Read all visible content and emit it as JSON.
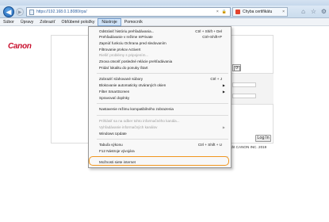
{
  "browser": {
    "url": "https://192.168.0.1.8080/rps/",
    "tab_title": "Chyba certifikátu",
    "url_tools": [
      "×",
      "🔒"
    ]
  },
  "menubar": {
    "items": [
      "Súbor",
      "Úpravy",
      "Zobraziť",
      "Obľúbené položky",
      "Nástroje",
      "Pomocník"
    ],
    "active_index": 4
  },
  "page": {
    "logo": "Canon",
    "login_label": "Log In",
    "copyright": "ight CANON INC. 2019"
  },
  "tools_menu": {
    "items": [
      {
        "label": "Odstrániť históriu prehľadávania...",
        "shortcut": "Ctrl + Shift + Del",
        "disabled": false
      },
      {
        "label": "Prehľadávanie v režime InPrivate",
        "shortcut": "Ctrl+Shift+P",
        "disabled": false
      },
      {
        "label": "Zapnúť funkciu Ochrana pred sledovaním",
        "shortcut": "",
        "disabled": false
      },
      {
        "label": "Filtrovanie prvkov ActiveX",
        "shortcut": "",
        "disabled": false
      },
      {
        "label": "Riešiť problémy s pripojením...",
        "shortcut": "",
        "disabled": true
      },
      {
        "label": "Znova otvoriť posledné relácie prehľadávania",
        "shortcut": "",
        "disabled": false
      },
      {
        "label": "Pridať lokalitu do ponuky Štart",
        "shortcut": "",
        "disabled": false
      },
      {
        "label": "Zobraziť sťahované súbory",
        "shortcut": "Ctrl + J",
        "disabled": false
      },
      {
        "label": "Blokovanie automaticky otváraných okien",
        "shortcut": "",
        "disabled": false,
        "submenu": true
      },
      {
        "label": "Filter SmartScreen",
        "shortcut": "",
        "disabled": false,
        "submenu": true
      },
      {
        "label": "Spravovať doplnky",
        "shortcut": "",
        "disabled": false
      },
      {
        "label": "Nastavenie režimu kompatibilného zobrazenia",
        "shortcut": "",
        "disabled": false
      },
      {
        "label": "Prihlásiť sa na odber tohto informačného kanála...",
        "shortcut": "",
        "disabled": true
      },
      {
        "label": "Vyhľadávanie informačných kanálov",
        "shortcut": "",
        "disabled": true,
        "submenu": true
      },
      {
        "label": "Windows Update",
        "shortcut": "",
        "disabled": false
      },
      {
        "label": "Tabuľa výkonu",
        "shortcut": "Ctrl + Shift + U",
        "disabled": false
      },
      {
        "label": "F12 Nástroje vývojára",
        "shortcut": "",
        "disabled": false
      },
      {
        "label": "Možnosti siete internet",
        "shortcut": "",
        "disabled": false
      }
    ]
  },
  "colors": {
    "highlight": "#f0961e",
    "canon_red": "#c8102e",
    "active_menu": "#cfe2f7"
  }
}
